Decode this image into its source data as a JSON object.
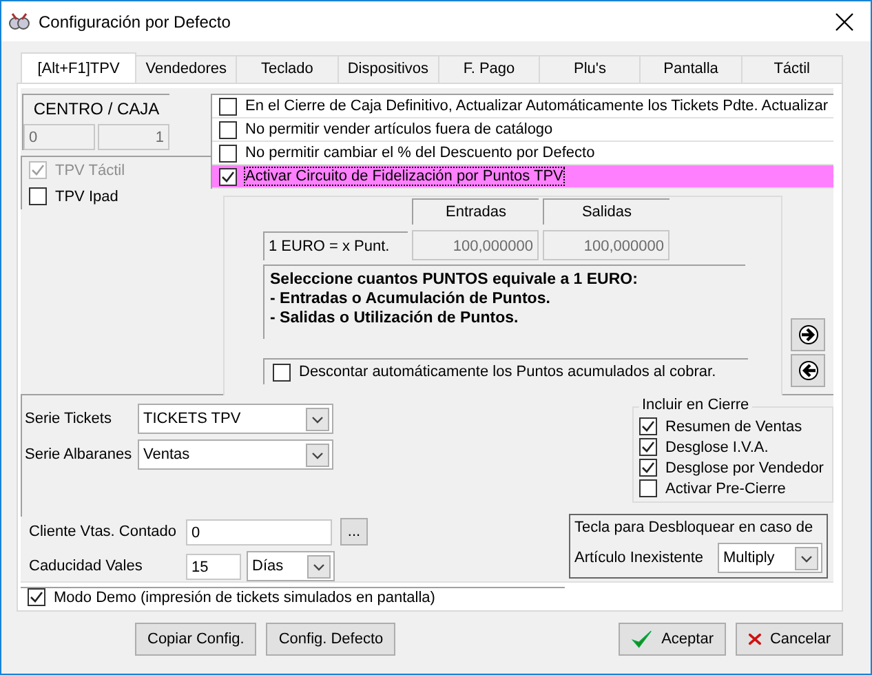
{
  "window": {
    "title": "Configuración por Defecto"
  },
  "tabs": [
    {
      "label": "[Alt+F1]TPV",
      "selected": true
    },
    {
      "label": "Vendedores",
      "selected": false
    },
    {
      "label": "Teclado",
      "selected": false
    },
    {
      "label": "Dispositivos",
      "selected": false
    },
    {
      "label": "F. Pago",
      "selected": false
    },
    {
      "label": "Plu's",
      "selected": false
    },
    {
      "label": "Pantalla",
      "selected": false
    },
    {
      "label": "Táctil",
      "selected": false
    }
  ],
  "centro_caja": {
    "title": "CENTRO / CAJA",
    "centro": "0",
    "caja": "1"
  },
  "terminal_options": [
    {
      "label": "TPV Táctil",
      "checked": true,
      "disabled": true
    },
    {
      "label": "TPV Ipad",
      "checked": false,
      "disabled": false
    }
  ],
  "options": [
    {
      "label": "En el Cierre de Caja Definitivo, Actualizar Automáticamente los Tickets Pdte. Actualizar",
      "checked": false,
      "highlighted": false
    },
    {
      "label": "No permitir vender artículos fuera de catálogo",
      "checked": false,
      "highlighted": false
    },
    {
      "label": "No permitir cambiar el % del Descuento por Defecto",
      "checked": false,
      "highlighted": false
    },
    {
      "label": "Activar Circuito de Fidelización por Puntos TPV",
      "checked": true,
      "highlighted": true
    }
  ],
  "fidelizacion": {
    "columns": [
      "Entradas",
      "Salidas"
    ],
    "row_label": "1 EURO = x Punt.",
    "values": [
      "100,000000",
      "100,000000"
    ],
    "description": [
      "Seleccione cuantos PUNTOS equivale a 1 EURO:",
      "- Entradas o Acumulación de Puntos.",
      "- Salidas o Utilización de Puntos."
    ],
    "auto_discount": {
      "label": "Descontar automáticamente los Puntos acumulados al cobrar.",
      "checked": false
    }
  },
  "series": [
    {
      "label": "Serie Tickets",
      "value": "TICKETS TPV"
    },
    {
      "label": "Serie Albaranes",
      "value": "Ventas"
    }
  ],
  "incluir_en_cierre": {
    "title": "Incluir en Cierre",
    "items": [
      {
        "label": "Resumen de Ventas",
        "checked": true
      },
      {
        "label": "Desglose I.V.A.",
        "checked": true
      },
      {
        "label": "Desglose por Vendedor",
        "checked": true
      },
      {
        "label": "Activar Pre-Cierre",
        "checked": false
      }
    ]
  },
  "cliente": {
    "label": "Cliente Vtas. Contado",
    "value": "0",
    "browse": "..."
  },
  "caducidad": {
    "label": "Caducidad Vales",
    "value": "15",
    "unit": "Días"
  },
  "tecla": {
    "line_1": "Tecla para Desbloquear en caso de",
    "line_2": "Artículo Inexistente",
    "value": "Multiply"
  },
  "modo_demo": {
    "label": "Modo Demo (impresión de tickets simulados en pantalla)",
    "checked": true
  },
  "buttons": [
    {
      "label": "Copiar Config.",
      "kind": "plain"
    },
    {
      "label": "Config. Defecto",
      "kind": "plain"
    },
    {
      "label": "Aceptar",
      "kind": "accept"
    },
    {
      "label": "Cancelar",
      "kind": "cancel"
    }
  ]
}
